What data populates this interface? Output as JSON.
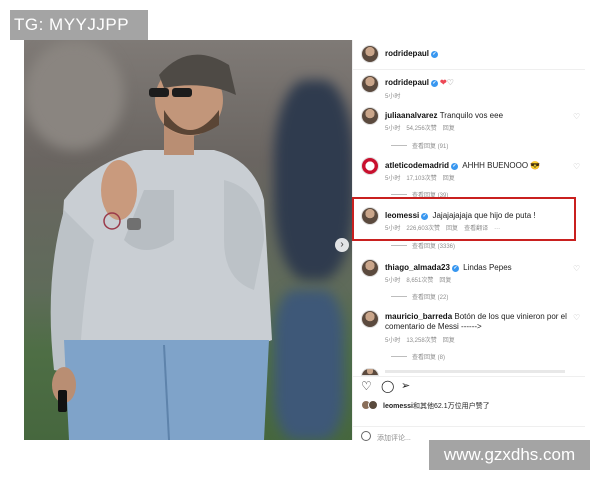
{
  "watermarks": {
    "top": "TG: MYYJJPP",
    "bottom": "www.gzxdhs.com"
  },
  "post": {
    "header_user": "rodridepaul",
    "caption": {
      "user": "rodridepaul",
      "time": "5小时"
    }
  },
  "comments": [
    {
      "user": "juliaanalvarez",
      "text": "Tranquilo vos eee",
      "time": "5小时",
      "likes": "54,256次赞",
      "reply": "回复",
      "view_replies": "查看回复 (91)"
    },
    {
      "user": "atleticodemadrid",
      "text": "AHHH BUENOOO 😎",
      "time": "5小时",
      "likes": "17,103次赞",
      "reply": "回复",
      "view_replies": "查看回复 (39)"
    },
    {
      "user": "leomessi",
      "text": "Jajajajajaja que hijo de puta !",
      "time": "5小时",
      "likes": "226,603次赞",
      "reply": "回复",
      "translate": "查看翻译",
      "more": "···",
      "view_replies": "查看回复 (3336)"
    },
    {
      "user": "thiago_almada23",
      "text": "Lindas Pepes",
      "time": "5小时",
      "likes": "8,651次赞",
      "reply": "回复",
      "view_replies": "查看回复 (22)"
    },
    {
      "user": "mauricio_barreda",
      "text": "Botón de los que vinieron por el comentario de Messi ------>",
      "time": "5小时",
      "likes": "13,258次赞",
      "reply": "回复",
      "view_replies": "查看回复 (8)"
    }
  ],
  "likes_line": {
    "user": "leomessi",
    "rest": "和其他62.1万位用户赞了"
  },
  "add_comment": "添加评论...",
  "icons": {
    "heart": "heart-icon",
    "comment": "comment-icon",
    "share": "share-icon",
    "verified": "verified-badge-icon",
    "next": "chevron-right-icon"
  },
  "colors": {
    "highlight": "#c9201f",
    "verified": "#3897f0",
    "like_red": "#ed4956"
  }
}
